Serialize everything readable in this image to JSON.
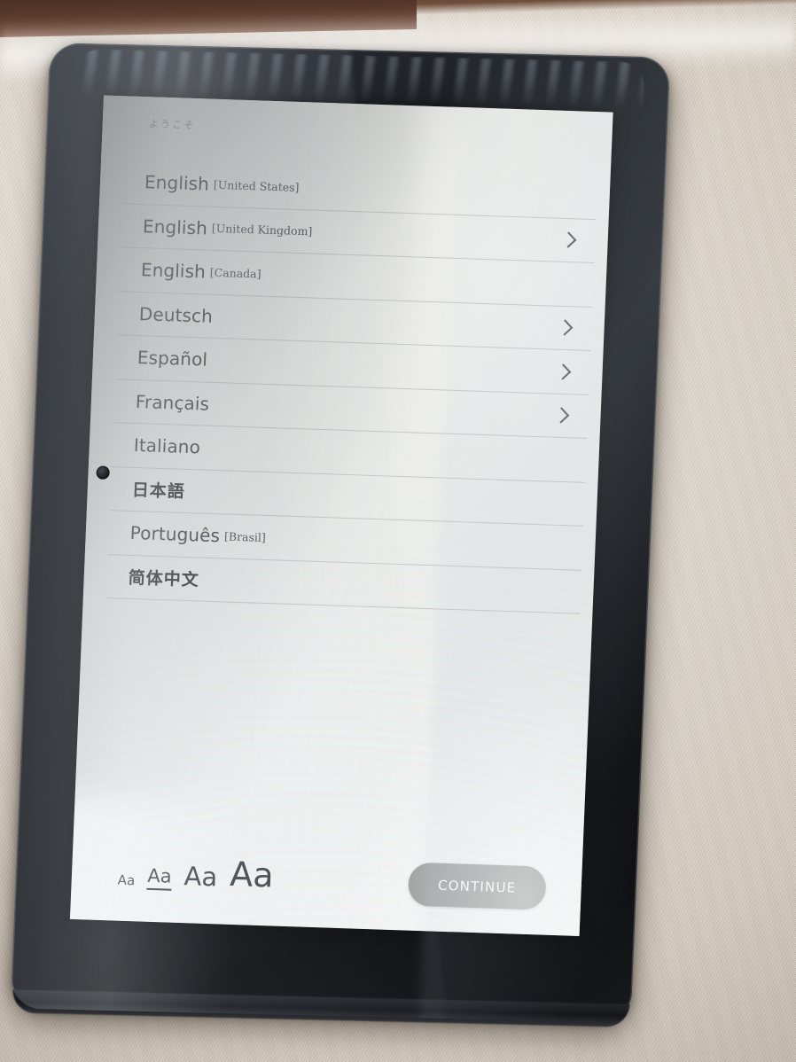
{
  "device": {
    "type": "tablet",
    "bezel_color": "#15171a",
    "camera_label": "front-camera"
  },
  "screen": {
    "background_color": "#e9eae6",
    "header": {
      "welcome_text": "ようこそ"
    },
    "language_list": [
      {
        "name": "English",
        "region": "[United States]",
        "cjk": false,
        "chevron": false
      },
      {
        "name": "English",
        "region": "[United Kingdom]",
        "cjk": false,
        "chevron": true
      },
      {
        "name": "English",
        "region": "[Canada]",
        "cjk": false,
        "chevron": false
      },
      {
        "name": "Deutsch",
        "region": "",
        "cjk": false,
        "chevron": true
      },
      {
        "name": "Español",
        "region": "",
        "cjk": false,
        "chevron": true
      },
      {
        "name": "Français",
        "region": "",
        "cjk": false,
        "chevron": true
      },
      {
        "name": "Italiano",
        "region": "",
        "cjk": false,
        "chevron": false
      },
      {
        "name": "日本語",
        "region": "",
        "cjk": true,
        "chevron": false
      },
      {
        "name": "Português",
        "region": "[Brasil]",
        "cjk": false,
        "chevron": false
      },
      {
        "name": "简体中文",
        "region": "",
        "cjk": true,
        "chevron": false
      }
    ],
    "font_size_selector": {
      "options": [
        {
          "label": "Aa",
          "size": "smallest",
          "selected": false
        },
        {
          "label": "Aa",
          "size": "small",
          "selected": true
        },
        {
          "label": "Aa",
          "size": "medium",
          "selected": false
        },
        {
          "label": "Aa",
          "size": "large",
          "selected": false
        }
      ]
    },
    "continue_button": {
      "label": "CONTINUE",
      "background_color": "#8d8e8b",
      "text_color": "#fdfdfc"
    }
  }
}
